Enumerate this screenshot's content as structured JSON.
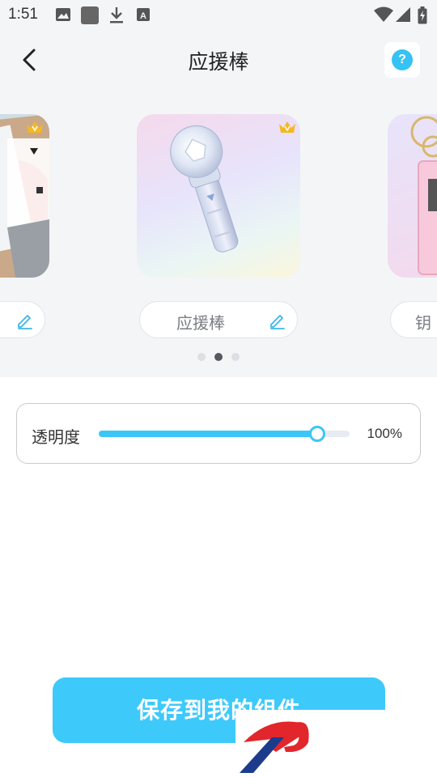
{
  "status_bar": {
    "time": "1:51",
    "icons": [
      "image-icon",
      "square-app-icon",
      "download-icon",
      "font-a-icon",
      "wifi-icon",
      "cellular-signal-icon",
      "battery-charging-icon"
    ]
  },
  "header": {
    "title": "应援棒",
    "back_icon": "chevron-left-icon",
    "help_icon": "question-mark-icon",
    "help_symbol": "?"
  },
  "carousel": {
    "items": [
      {
        "label": "",
        "premium": true,
        "image": "photo-collage"
      },
      {
        "label": "应援棒",
        "premium": true,
        "image": "light-stick"
      },
      {
        "label": "钥",
        "premium": false,
        "image": "keychain"
      }
    ],
    "active_index": 1,
    "page_count": 3
  },
  "opacity": {
    "label": "透明度",
    "value_text": "100%",
    "value": 1.0
  },
  "save_button": {
    "label": "保存到我的组件"
  },
  "colors": {
    "accent": "#3ec9fb",
    "background": "#f4f5f7",
    "crown": "#f5b81e"
  }
}
